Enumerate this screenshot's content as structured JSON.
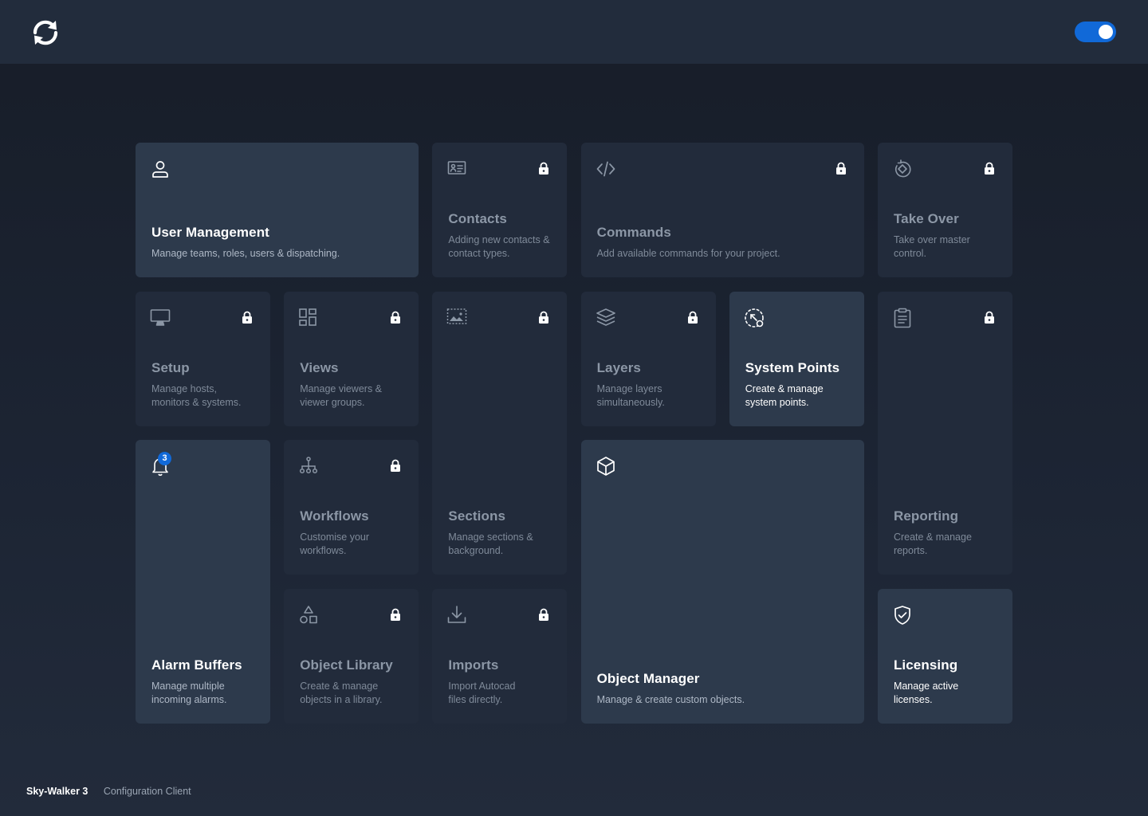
{
  "header": {
    "toggle_state": "on"
  },
  "tiles": {
    "user_management": {
      "title": "User Management",
      "desc": "Manage teams, roles, users & dispatching.",
      "icon": "user-icon"
    },
    "contacts": {
      "title": "Contacts",
      "desc": "Adding new contacts & contact types.",
      "icon": "contact-card-icon"
    },
    "commands": {
      "title": "Commands",
      "desc": "Add available commands for your project.",
      "icon": "code-icon"
    },
    "take_over": {
      "title": "Take Over",
      "desc": "Take over master control.",
      "icon": "rotate-icon"
    },
    "setup": {
      "title": "Setup",
      "desc": "Manage hosts, monitors & systems.",
      "icon": "monitor-icon"
    },
    "views": {
      "title": "Views",
      "desc": "Manage viewers & viewer groups.",
      "icon": "dashboard-icon"
    },
    "sections": {
      "title": "Sections",
      "desc": "Manage sections & background.",
      "icon": "image-icon"
    },
    "layers": {
      "title": "Layers",
      "desc": "Manage layers simultaneously.",
      "icon": "layers-icon"
    },
    "system_points": {
      "title": "System Points",
      "desc": "Create & manage system points.",
      "icon": "cursor-point-icon"
    },
    "reporting": {
      "title": "Reporting",
      "desc": "Create & manage reports.",
      "icon": "report-icon"
    },
    "alarm_buffers": {
      "title": "Alarm Buffers",
      "desc": "Manage multiple incoming alarms.",
      "icon": "bell-icon",
      "badge": "3"
    },
    "workflows": {
      "title": "Workflows",
      "desc": "Customise your workflows.",
      "icon": "workflow-icon"
    },
    "object_manager": {
      "title": "Object Manager",
      "desc": "Manage & create custom objects.",
      "icon": "cube-icon"
    },
    "object_library": {
      "title": "Object Library",
      "desc": "Create & manage objects in a library.",
      "icon": "shapes-icon"
    },
    "imports": {
      "title": "Imports",
      "desc": "Import Autocad files directly.",
      "icon": "download-icon"
    },
    "licensing": {
      "title": "Licensing",
      "desc": "Manage active licenses.",
      "icon": "shield-check-icon"
    }
  },
  "footer": {
    "brand": "Sky-Walker 3",
    "client": "Configuration Client"
  },
  "colors": {
    "accent": "#1169d8",
    "background": "#1c2433",
    "tile": "#222b3b",
    "tile_open": "#2d3a4c"
  }
}
